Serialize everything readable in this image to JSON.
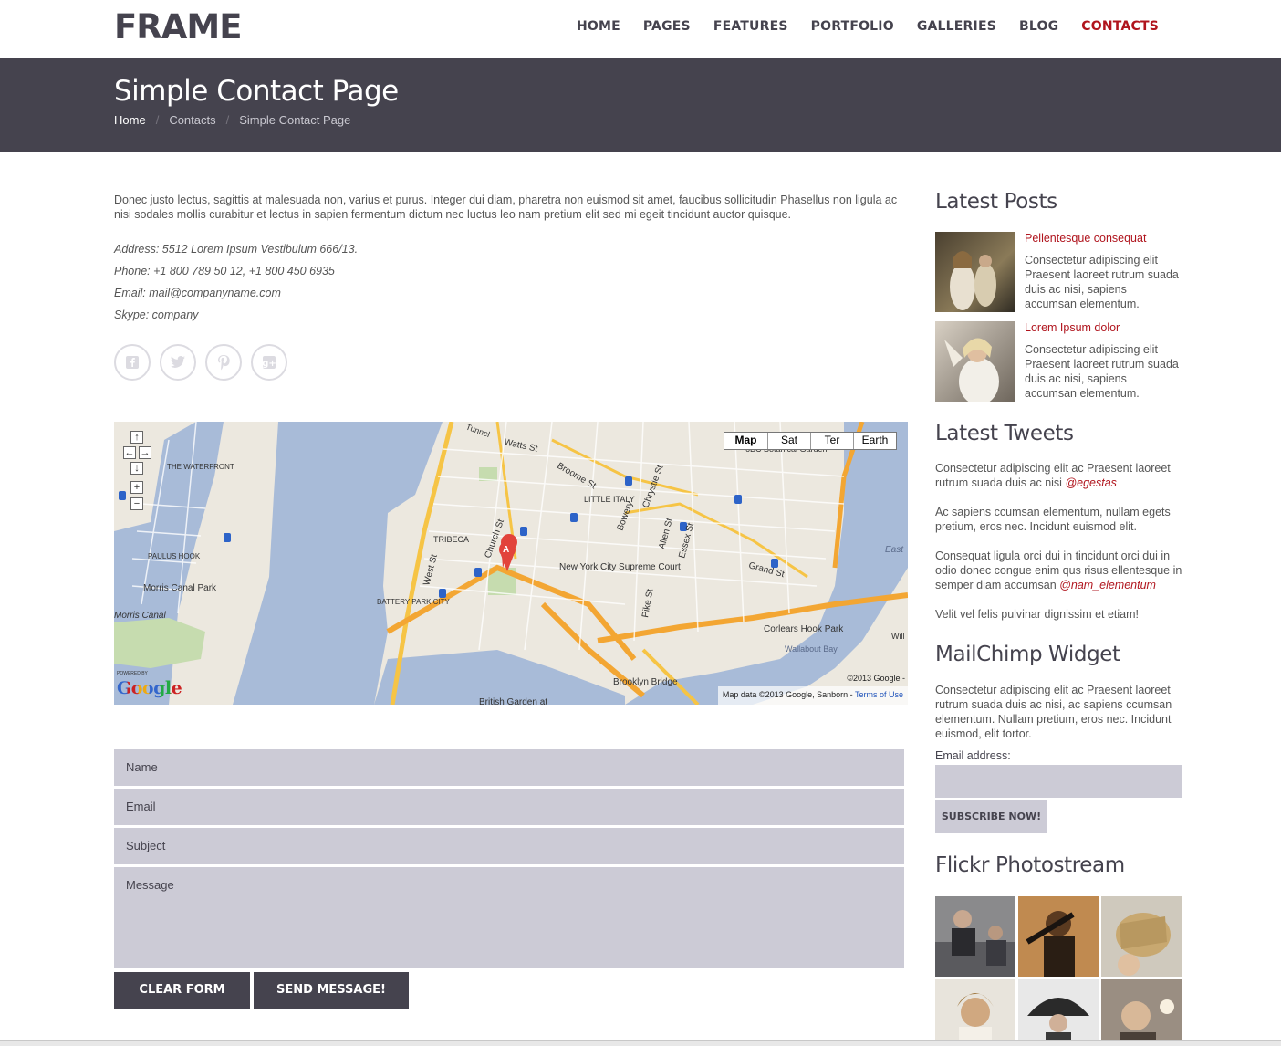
{
  "header": {
    "logo": "FRAME",
    "nav": [
      {
        "label": "HOME"
      },
      {
        "label": "PAGES"
      },
      {
        "label": "FEATURES"
      },
      {
        "label": "PORTFOLIO"
      },
      {
        "label": "GALLERIES"
      },
      {
        "label": "BLOG"
      },
      {
        "label": "CONTACTS",
        "active": true
      }
    ]
  },
  "title_band": {
    "title": "Simple Contact Page",
    "breadcrumb": [
      "Home",
      "Contacts",
      "Simple Contact Page"
    ],
    "separator": "/"
  },
  "intro": "Donec justo lectus, sagittis at malesuada non, varius et purus. Integer dui diam, pharetra non euismod sit amet, faucibus sollicitudin Phasellus non ligula ac nisi sodales mollis curabitur et lectus in sapien fermentum dictum nec luctus leo nam pretium elit sed mi egeit tincidunt auctor quisque.",
  "contact_info": {
    "address": "Address: 5512 Lorem Ipsum Vestibulum 666/13.",
    "phone": "Phone: +1 800 789 50 12, +1 800 450 6935",
    "email": "Email: mail@companyname.com",
    "skype": "Skype: company"
  },
  "social": [
    {
      "icon": "facebook-icon"
    },
    {
      "icon": "twitter-icon"
    },
    {
      "icon": "pinterest-icon"
    },
    {
      "icon": "google-plus-icon"
    }
  ],
  "map": {
    "types": [
      "Map",
      "Sat",
      "Ter",
      "Earth"
    ],
    "labels": {
      "watts": "Watts St",
      "broome": "Broome St",
      "little_italy": "LITTLE ITALY",
      "chrystie": "Chrystie St",
      "bowery": "Bowery",
      "allen": "Allen St",
      "essex": "Essex St",
      "grand": "Grand St",
      "tribeca": "TRIBECA",
      "church": "Church St",
      "west": "West St",
      "nyc_court": "New York City Supreme Court",
      "pike": "Pike St",
      "battery": "BATTERY PARK CITY",
      "waterfront": "THE WATERFRONT",
      "paulus": "PAULUS HOOK",
      "morris": "Morris Canal Park",
      "morris2": "Morris Canal",
      "corlears": "Corlears Hook Park",
      "wallabout": "Wallabout Bay",
      "brooklyn": "Brooklyn Bridge",
      "british": "British Garden at",
      "botanical": "6BC Botanical Garden",
      "east": "East",
      "tunnel": "Tunnel",
      "will": "Will"
    },
    "marker": "A",
    "powered_by": "POWERED BY",
    "google": "Google",
    "copyright": "©2013 Google -",
    "attribution": "Map data ©2013 Google, Sanborn - ",
    "terms": "Terms of Use"
  },
  "form": {
    "name": "Name",
    "email": "Email",
    "subject": "Subject",
    "message": "Message",
    "clear": "CLEAR FORM",
    "send": "SEND MESSAGE!"
  },
  "sidebar": {
    "latest_posts": {
      "title": "Latest Posts",
      "posts": [
        {
          "title": "Pellentesque consequat",
          "text": "Consectetur adipiscing elit Praesent laoreet rutrum suada duis ac nisi, sapiens accumsan elementum."
        },
        {
          "title": "Lorem Ipsum dolor",
          "text": "Consectetur adipiscing elit Praesent laoreet rutrum suada duis ac nisi, sapiens accumsan elementum."
        }
      ]
    },
    "latest_tweets": {
      "title": "Latest Tweets",
      "tweets": [
        {
          "text": "Consectetur adipiscing elit ac Praesent laoreet rutrum suada duis ac nisi ",
          "handle": "@egestas"
        },
        {
          "text": "Ac sapiens ccumsan elementum, nullam egets pretium, eros nec. Incidunt euismod elit.",
          "handle": ""
        },
        {
          "text": "Consequat ligula orci dui in tincidunt orci dui in odio donec congue enim qus risus ellentesque in semper diam accumsan ",
          "handle": "@nam_elementum"
        },
        {
          "text": "Velit vel felis pulvinar dignissim et etiam!",
          "handle": ""
        }
      ]
    },
    "mailchimp": {
      "title": "MailChimp Widget",
      "text": "Consectetur adipiscing elit ac Praesent laoreet rutrum suada duis ac nisi, ac sapiens ccumsan elementum. Nullam pretium, eros nec. Incidunt euismod, elit tortor.",
      "label": "Email address:",
      "button": "SUBSCRIBE NOW!"
    },
    "flickr": {
      "title": "Flickr Photostream"
    }
  }
}
